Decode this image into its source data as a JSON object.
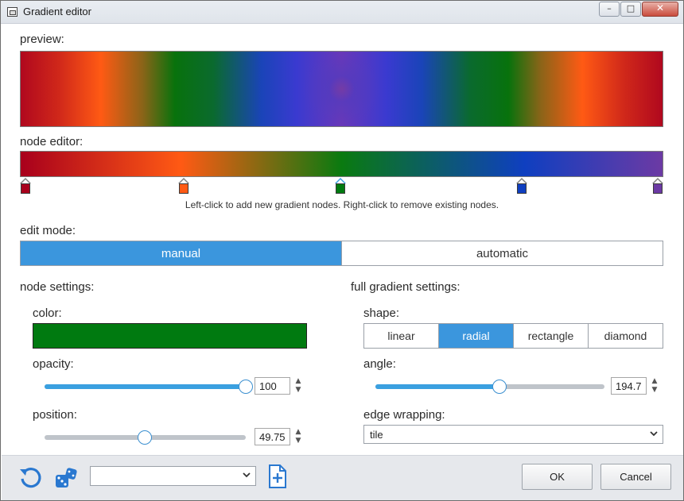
{
  "window": {
    "title": "Gradient editor",
    "minimize_glyph": "–",
    "maximize_glyph": "□",
    "close_glyph": "✕"
  },
  "preview": {
    "label": "preview:"
  },
  "node_editor": {
    "label": "node editor:",
    "hint": "Left-click to add new gradient nodes.  Right-click to remove existing nodes.",
    "nodes": [
      {
        "position": 0,
        "color": "#a8001c"
      },
      {
        "position": 25,
        "color": "#ff5a14"
      },
      {
        "position": 49.75,
        "color": "#007a10",
        "selected": true
      },
      {
        "position": 78.5,
        "color": "#0f3fc0"
      },
      {
        "position": 100,
        "color": "#6c3aa4"
      }
    ]
  },
  "edit_mode": {
    "label": "edit mode:",
    "options": [
      "manual",
      "automatic"
    ],
    "selected": "manual"
  },
  "node_settings": {
    "label": "node settings:",
    "color_label": "color:",
    "color_value": "#007a10",
    "opacity_label": "opacity:",
    "opacity_value": "100",
    "opacity_fraction": 1.0,
    "position_label": "position:",
    "position_value": "49.75",
    "position_fraction": 0.4975
  },
  "full_gradient_settings": {
    "label": "full gradient settings:",
    "shape_label": "shape:",
    "shapes": [
      "linear",
      "radial",
      "rectangle",
      "diamond"
    ],
    "shape_selected": "radial",
    "angle_label": "angle:",
    "angle_value": "194.7",
    "angle_fraction": 0.541,
    "edge_wrapping_label": "edge wrapping:",
    "edge_wrapping_value": "tile"
  },
  "footer": {
    "preset_value": "",
    "ok_label": "OK",
    "cancel_label": "Cancel"
  },
  "colors": {
    "accent": "#3b96dd",
    "selected_node": "#3aa0e0"
  }
}
